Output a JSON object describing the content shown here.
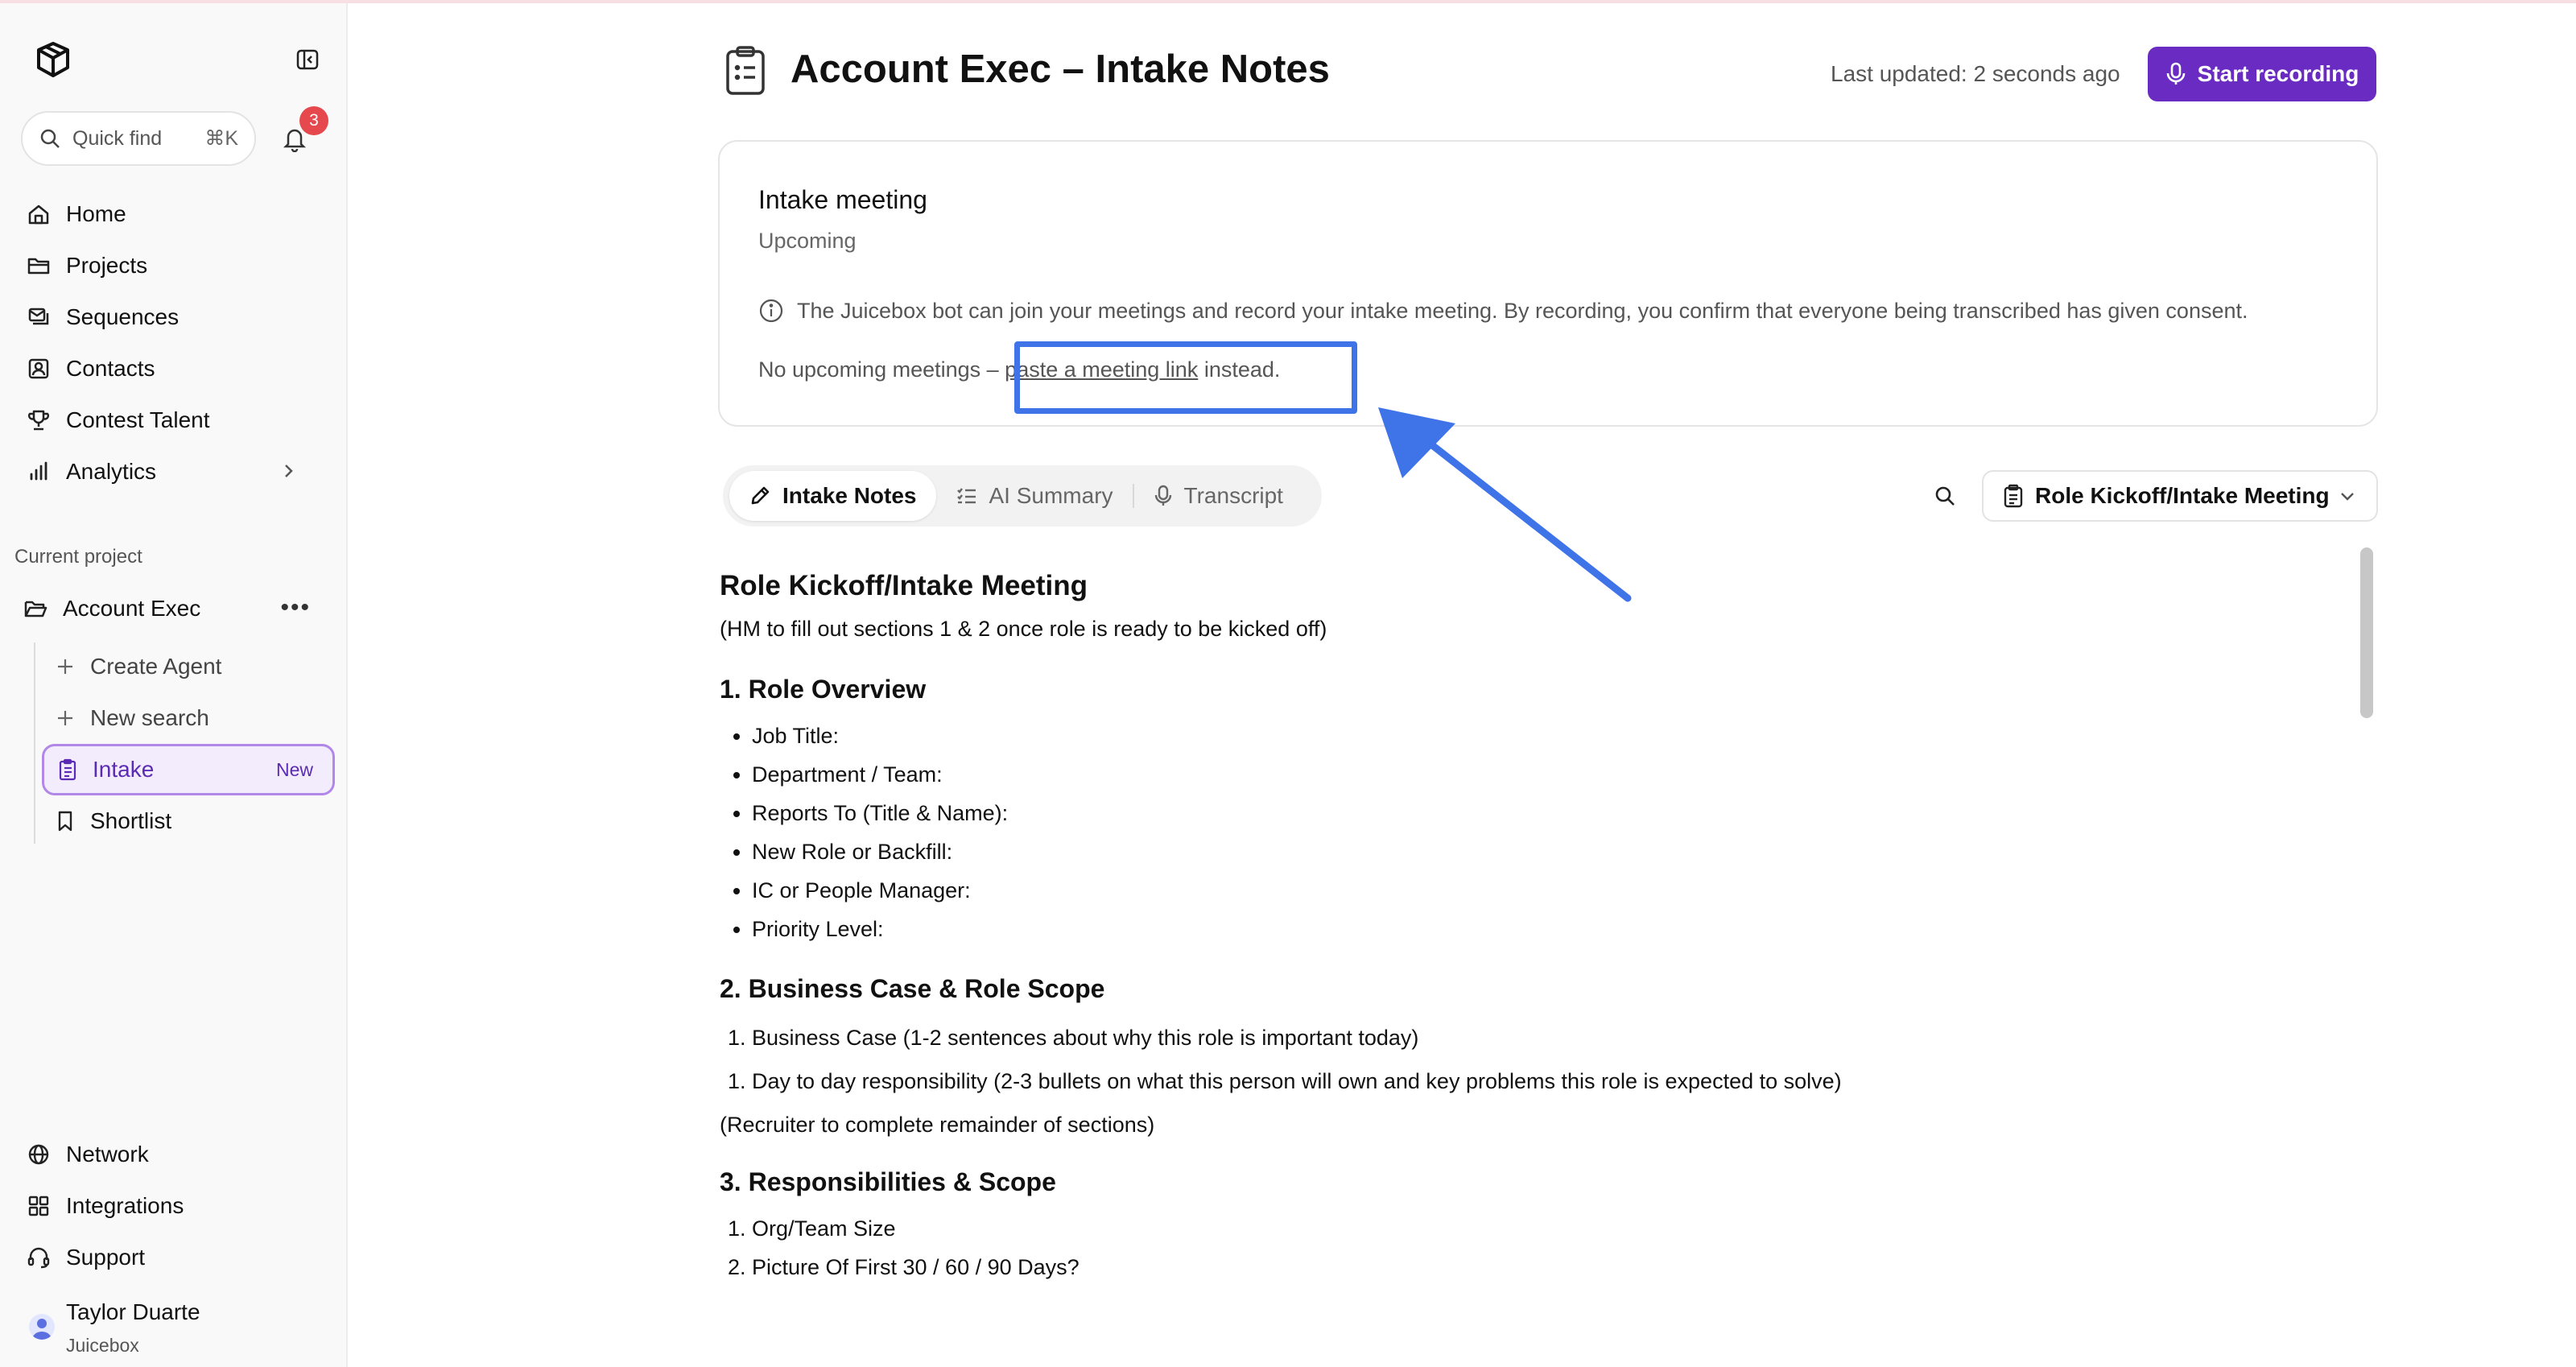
{
  "sidebar": {
    "quickfind": {
      "label": "Quick find",
      "shortcut": "⌘K"
    },
    "notifications": {
      "count": "3"
    },
    "nav": [
      {
        "label": "Home",
        "icon": "home-icon"
      },
      {
        "label": "Projects",
        "icon": "folder-icon"
      },
      {
        "label": "Sequences",
        "icon": "sequences-icon"
      },
      {
        "label": "Contacts",
        "icon": "contacts-icon"
      },
      {
        "label": "Contest Talent",
        "icon": "trophy-icon"
      },
      {
        "label": "Analytics",
        "icon": "bar-chart-icon"
      }
    ],
    "current_project_label": "Current project",
    "project": {
      "name": "Account Exec",
      "more": "•••"
    },
    "sub_items": [
      {
        "label": "Create Agent"
      },
      {
        "label": "New search"
      },
      {
        "label": "Intake",
        "tag": "New"
      },
      {
        "label": "Shortlist"
      }
    ],
    "bottom_nav": [
      {
        "label": "Network"
      },
      {
        "label": "Integrations"
      },
      {
        "label": "Support"
      }
    ],
    "user": {
      "name": "Taylor Duarte",
      "org": "Juicebox"
    }
  },
  "header": {
    "title": "Account Exec – Intake Notes",
    "last_updated": "Last updated: 2 seconds ago",
    "record_label": "Start recording"
  },
  "meeting_card": {
    "title": "Intake meeting",
    "status": "Upcoming",
    "info": "The Juicebox bot can join your meetings and record your intake meeting. By recording, you confirm that everyone being transcribed has given consent.",
    "no_meetings_prefix": "No upcoming meetings – ",
    "link_text": "paste a meeting link",
    "no_meetings_suffix": " instead."
  },
  "tabs": [
    {
      "label": "Intake Notes"
    },
    {
      "label": "AI Summary"
    },
    {
      "label": "Transcript"
    }
  ],
  "template_select": {
    "value": "Role Kickoff/Intake Meeting"
  },
  "doc": {
    "title": "Role Kickoff/Intake Meeting",
    "subtitle": "(HM to fill out sections 1 & 2 once role is ready to be kicked off)",
    "s1": {
      "heading": "1. Role Overview",
      "items": [
        "Job Title:",
        "Department / Team:",
        "Reports To (Title & Name):",
        "New Role or Backfill:",
        "IC or People Manager:",
        "Priority Level:"
      ]
    },
    "s2": {
      "heading": "2. Business Case & Role Scope",
      "items": [
        "Business Case (1-2 sentences about why this role is important today)",
        "Day to day responsibility (2-3 bullets on what this person will own and key problems this role is expected to solve)"
      ],
      "note": "(Recruiter to complete remainder of sections)"
    },
    "s3": {
      "heading": "3. Responsibilities & Scope",
      "items": [
        "Org/Team Size",
        "Picture Of First 30 / 60 / 90 Days?"
      ]
    }
  },
  "colors": {
    "accent": "#6a2bc2",
    "highlight": "#3f73e8",
    "badge": "#e5484d"
  }
}
